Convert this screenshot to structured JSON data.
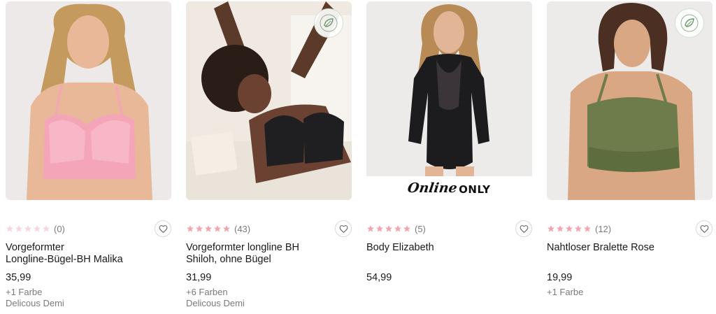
{
  "products": [
    {
      "name_line1": "Vorgeformter",
      "name_line2": "Longline-Bügel-BH Malika",
      "rating": 0,
      "review_count": "(0)",
      "price": "35,99",
      "colors": "+1 Farbe",
      "collection": "Delicous Demi",
      "image": "pink-longline-bra-photo",
      "sustainable_badge": false,
      "online_only": false
    },
    {
      "name_line1": "Vorgeformter longline BH",
      "name_line2": "Shiloh, ohne Bügel",
      "rating": 4.5,
      "review_count": "(43)",
      "price": "31,99",
      "colors": "+6 Farben",
      "collection": "Delicous Demi",
      "image": "black-lace-bra-photo",
      "sustainable_badge": true,
      "online_only": false
    },
    {
      "name_line1": "Body Elizabeth",
      "name_line2": "",
      "rating": 5,
      "review_count": "(5)",
      "price": "54,99",
      "colors": "",
      "collection": "",
      "image": "black-lace-bodysuit-photo",
      "sustainable_badge": false,
      "online_only": true
    },
    {
      "name_line1": "Nahtloser Bralette Rose",
      "name_line2": "",
      "rating": 5,
      "review_count": "(12)",
      "price": "19,99",
      "colors": "+1 Farbe",
      "collection": "",
      "image": "green-bralette-photo",
      "sustainable_badge": true,
      "online_only": false
    }
  ],
  "labels": {
    "online": "Online",
    "only": "ONLY",
    "sustainable_badge": "TOGETHER TOMORROW SUSTAINABLE"
  },
  "colors": {
    "star_filled": "#f2a6ae",
    "star_empty": "#f6d6da",
    "text_primary": "#1a1a1a",
    "text_muted": "#7a7a7a"
  }
}
